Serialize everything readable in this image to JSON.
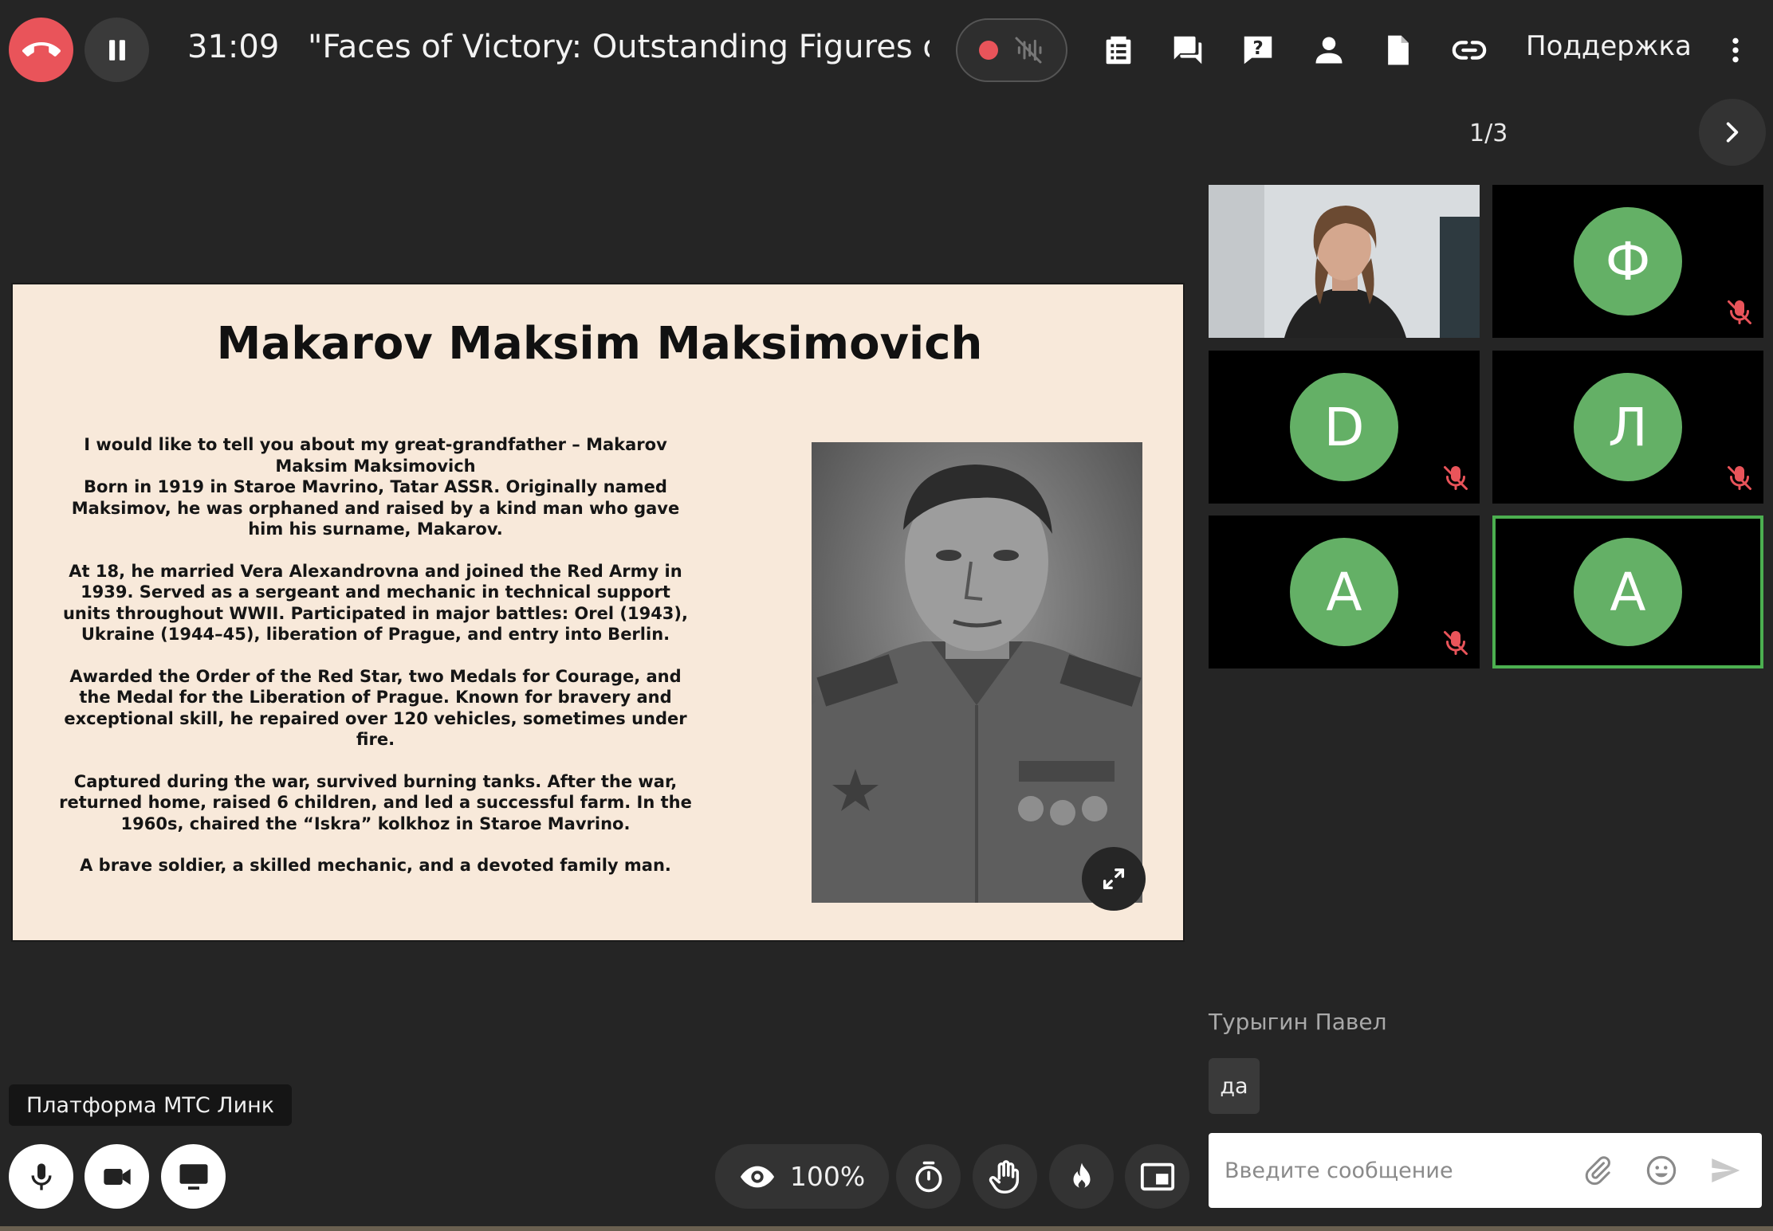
{
  "header": {
    "timer": "31:09",
    "event_title": "\"Faces of Victory: Outstanding Figures of",
    "support_label": "Поддержка",
    "icons": [
      "agenda-icon",
      "chat-icon",
      "help-icon",
      "participants-icon",
      "file-icon",
      "link-icon",
      "more-icon"
    ]
  },
  "pagination": {
    "indicator": "1/3"
  },
  "slide": {
    "title": "Makarov Maksim Maksimovich",
    "paragraphs": [
      [
        "I would like to tell you about my great-grandfather – Makarov Maksim Maksimovich",
        "Born in 1919 in Staroe Mavrino, Tatar ASSR. Originally named Maksimov, he was orphaned and raised by a kind man who gave him his surname, Makarov."
      ],
      [
        "At 18, he married Vera Alexandrovna and joined the Red Army in 1939. Served as a sergeant and mechanic in technical support units throughout WWII. Participated in major battles: Orel (1943), Ukraine (1944–45), liberation of Prague, and entry into Berlin."
      ],
      [
        "Awarded the Order of the Red Star, two Medals for Courage, and the Medal for the Liberation of Prague. Known for bravery and exceptional skill, he repaired over 120 vehicles, sometimes under fire."
      ],
      [
        "Captured during the war, survived burning tanks. After the war, returned home, raised 6 children, and led a successful farm. In the 1960s, chaired the “Iskra” kolkhoz in Staroe Mavrino."
      ],
      [
        "A brave soldier, a skilled mechanic, and a devoted family man."
      ]
    ]
  },
  "participants": [
    {
      "type": "video",
      "muted": false
    },
    {
      "initial": "Ф",
      "muted": true
    },
    {
      "initial": "D",
      "muted": true
    },
    {
      "initial": "Л",
      "muted": true
    },
    {
      "initial": "A",
      "muted": true
    },
    {
      "initial": "A",
      "muted": false,
      "active": true
    }
  ],
  "chat": {
    "author": "Турыгин Павел",
    "message": "да",
    "input_placeholder": "Введите сообщение"
  },
  "footer": {
    "platform_label": "Платформа МТС Линк",
    "zoom": "100%"
  },
  "colors": {
    "hangup": "#e9545a",
    "avatar": "#64b066",
    "active_border": "#4caf50",
    "slide_bg": "#f8e9da",
    "mic_off": "#e9545a"
  }
}
